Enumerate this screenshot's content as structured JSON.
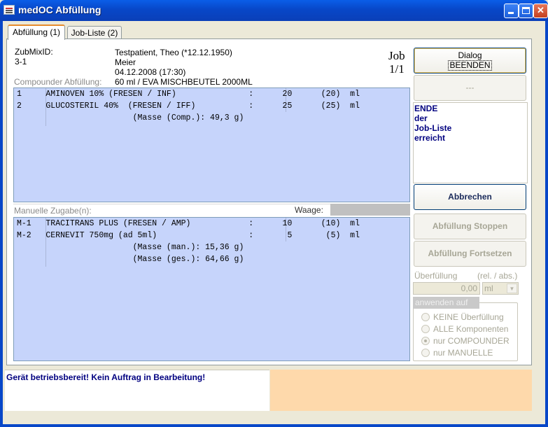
{
  "window": {
    "title": "medOC Abfüllung"
  },
  "tabs": [
    {
      "label": "Abfüllung (1)"
    },
    {
      "label": "Job-Liste (2)"
    }
  ],
  "header": {
    "zubmix_label": "ZubMixID:",
    "zubmix_value": "3-1",
    "patient": "Testpatient, Theo (*12.12.1950)",
    "doctor": "Meier",
    "datetime": "04.12.2008 (17:30)",
    "volume": "60 ml / EVA MISCHBEUTEL 2000ML",
    "job_label": "Job",
    "job_count": "1/1"
  },
  "compounder": {
    "label": "Compounder Abfüllung:",
    "rows": [
      "1     AMINOVEN 10% (FRESEN / INF)               :      20      (20)  ml",
      "2     GLUCOSTERIL 40%  (FRESEN / IFF)           :      25      (25)  ml",
      "                        (Masse (Comp.): 49,3 g)"
    ]
  },
  "manual": {
    "label": "Manuelle Zugabe(n):",
    "scale_label": "Waage:",
    "rows": [
      "M-1   TRACITRANS PLUS (FRESEN / AMP)            :      10      (10)  ml",
      "M-2   CERNEVIT 750mg (ad 5ml)                   :       5       (5)  ml",
      "                        (Masse (man.): 15,36 g)",
      "                        (Masse (ges.): 64,66 g)"
    ]
  },
  "side": {
    "dialog_button": [
      "Dialog",
      "BEENDEN"
    ],
    "placeholder_button": "---",
    "message_lines": [
      "ENDE",
      "der",
      "Job-Liste",
      "erreicht"
    ],
    "cancel_button": "Abbrechen",
    "stop_button": "Abfüllung Stoppen",
    "continue_button": "Abfüllung Fortsetzen",
    "overfill_label": "Überfüllung",
    "overfill_mode": "(rel. / abs.)",
    "overfill_value": "0,00",
    "overfill_unit": "ml",
    "apply_label": "anwenden auf",
    "apply_options": [
      "KEINE Überfüllung",
      "ALLE Komponenten",
      "nur COMPOUNDER",
      "nur MANUELLE"
    ],
    "apply_selected": "nur COMPOUNDER"
  },
  "status": {
    "text": "Gerät betriebsbereit! Kein Auftrag in Bearbeitung!"
  },
  "colors": {
    "list_bg": "#c6d4fb",
    "status_right": "#fed9ab",
    "titlebar": "#0847c8"
  }
}
